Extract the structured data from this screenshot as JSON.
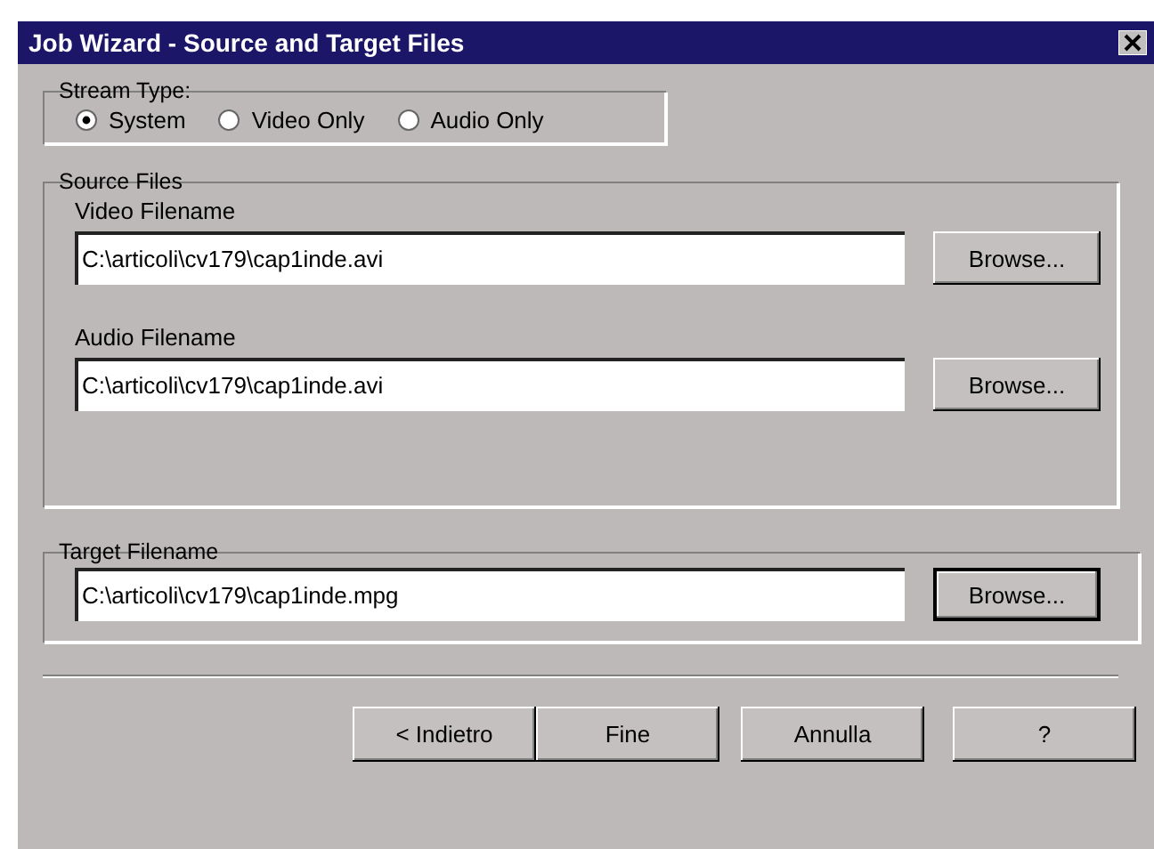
{
  "window": {
    "title": "Job Wizard - Source and Target Files"
  },
  "stream_type": {
    "label": "Stream Type:",
    "options": [
      {
        "label": "System",
        "selected": true
      },
      {
        "label": "Video Only",
        "selected": false
      },
      {
        "label": "Audio Only",
        "selected": false
      }
    ]
  },
  "source_files": {
    "label": "Source Files",
    "fields": [
      {
        "label": "Video Filename",
        "value": "C:\\articoli\\cv179\\cap1inde.avi",
        "button": "Browse...",
        "focused": false
      },
      {
        "label": "Audio Filename",
        "value": "C:\\articoli\\cv179\\cap1inde.avi",
        "button": "Browse...",
        "focused": false
      }
    ]
  },
  "target": {
    "label": "Target Filename",
    "value": "C:\\articoli\\cv179\\cap1inde.mpg",
    "button": "Browse...",
    "focused": true
  },
  "buttons": [
    "< Indietro",
    "Fine",
    "Annulla",
    "?"
  ]
}
